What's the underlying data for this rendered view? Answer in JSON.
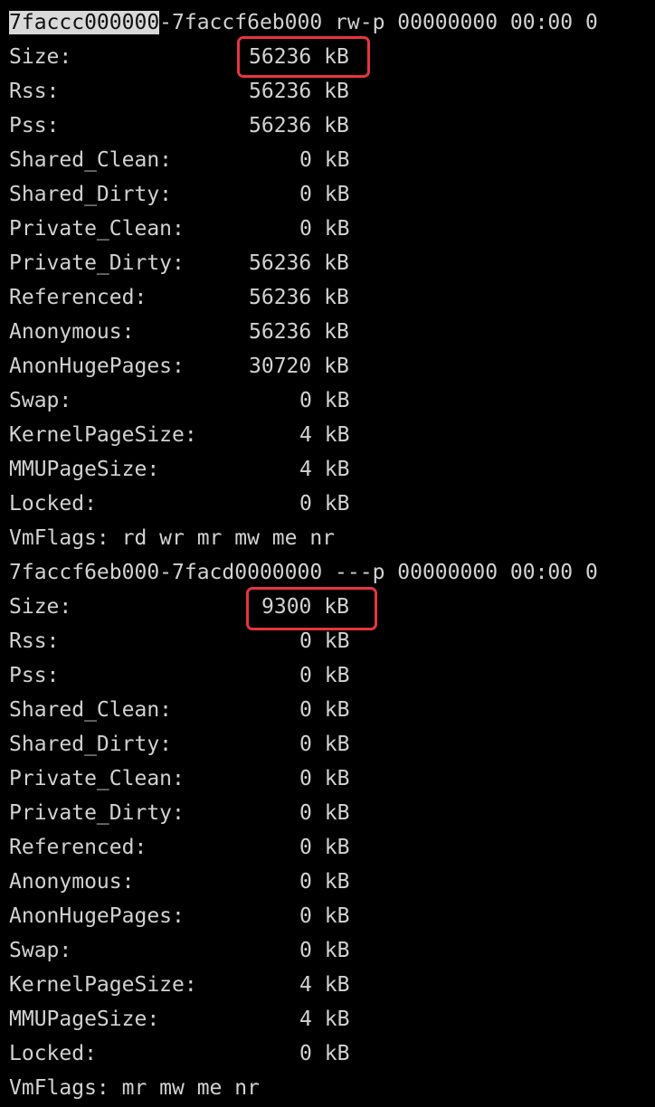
{
  "colors": {
    "background": "#000000",
    "text": "#d2d2d2",
    "selection_bg": "#d9d9d9",
    "highlight_box": "#e8343f"
  },
  "mapping1": {
    "header_selected": "7faccc000000",
    "header_rest": "-7faccf6eb000 rw-p 00000000 00:00 0",
    "rows": [
      {
        "key": "Size:",
        "num": "56236",
        "unit": "kB"
      },
      {
        "key": "Rss:",
        "num": "56236",
        "unit": "kB"
      },
      {
        "key": "Pss:",
        "num": "56236",
        "unit": "kB"
      },
      {
        "key": "Shared_Clean:",
        "num": "0",
        "unit": "kB"
      },
      {
        "key": "Shared_Dirty:",
        "num": "0",
        "unit": "kB"
      },
      {
        "key": "Private_Clean:",
        "num": "0",
        "unit": "kB"
      },
      {
        "key": "Private_Dirty:",
        "num": "56236",
        "unit": "kB"
      },
      {
        "key": "Referenced:",
        "num": "56236",
        "unit": "kB"
      },
      {
        "key": "Anonymous:",
        "num": "56236",
        "unit": "kB"
      },
      {
        "key": "AnonHugePages:",
        "num": "30720",
        "unit": "kB"
      },
      {
        "key": "Swap:",
        "num": "0",
        "unit": "kB"
      },
      {
        "key": "KernelPageSize:",
        "num": "4",
        "unit": "kB"
      },
      {
        "key": "MMUPageSize:",
        "num": "4",
        "unit": "kB"
      },
      {
        "key": "Locked:",
        "num": "0",
        "unit": "kB"
      }
    ],
    "vmflags": "VmFlags: rd wr mr mw me nr"
  },
  "mapping2": {
    "header": "7faccf6eb000-7facd0000000 ---p 00000000 00:00 0",
    "rows": [
      {
        "key": "Size:",
        "num": "9300",
        "unit": "kB"
      },
      {
        "key": "Rss:",
        "num": "0",
        "unit": "kB"
      },
      {
        "key": "Pss:",
        "num": "0",
        "unit": "kB"
      },
      {
        "key": "Shared_Clean:",
        "num": "0",
        "unit": "kB"
      },
      {
        "key": "Shared_Dirty:",
        "num": "0",
        "unit": "kB"
      },
      {
        "key": "Private_Clean:",
        "num": "0",
        "unit": "kB"
      },
      {
        "key": "Private_Dirty:",
        "num": "0",
        "unit": "kB"
      },
      {
        "key": "Referenced:",
        "num": "0",
        "unit": "kB"
      },
      {
        "key": "Anonymous:",
        "num": "0",
        "unit": "kB"
      },
      {
        "key": "AnonHugePages:",
        "num": "0",
        "unit": "kB"
      },
      {
        "key": "Swap:",
        "num": "0",
        "unit": "kB"
      },
      {
        "key": "KernelPageSize:",
        "num": "4",
        "unit": "kB"
      },
      {
        "key": "MMUPageSize:",
        "num": "4",
        "unit": "kB"
      },
      {
        "key": "Locked:",
        "num": "0",
        "unit": "kB"
      }
    ],
    "vmflags": "VmFlags: mr mw me nr"
  }
}
